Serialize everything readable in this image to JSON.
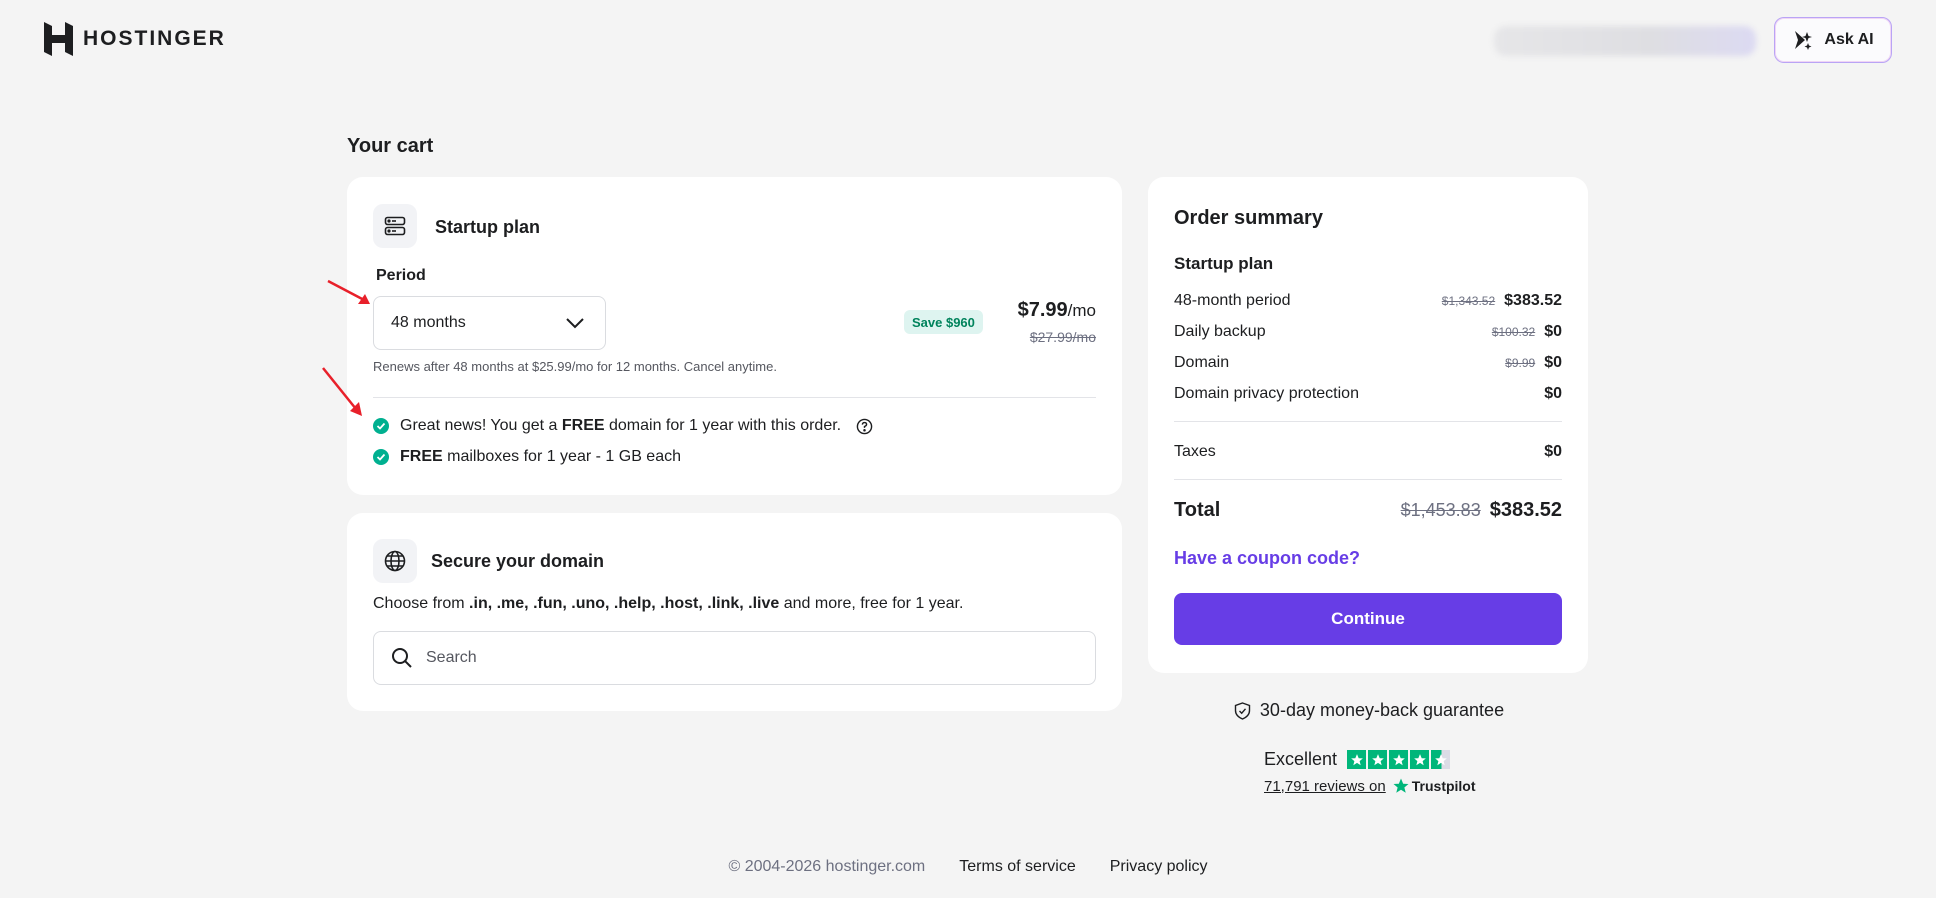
{
  "header": {
    "logo_text": "HOSTINGER",
    "ask_ai_label": "Ask AI"
  },
  "page_title": "Your cart",
  "plan_card": {
    "icon": "server-icon",
    "title": "Startup plan",
    "period_label": "Period",
    "period_value": "48 months",
    "save_badge": "Save $960",
    "price": "$7.99",
    "price_unit": "/mo",
    "old_price": "$27.99/mo",
    "renew_note": "Renews after 48 months at $25.99/mo for 12 months. Cancel anytime.",
    "perks": [
      {
        "pre": "Great news! You get a ",
        "bold": "FREE",
        "post": " domain for 1 year with this order."
      },
      {
        "pre": "",
        "bold": "FREE",
        "post": " mailboxes for 1 year - 1 GB each"
      }
    ]
  },
  "domain_card": {
    "icon": "globe-icon",
    "title": "Secure your domain",
    "desc_pre": "Choose from ",
    "desc_tlds": ".in, .me, .fun, .uno, .help, .host, .link, .live",
    "desc_post": " and more, free for 1 year.",
    "search_placeholder": "Search"
  },
  "summary": {
    "title": "Order summary",
    "plan_name": "Startup plan",
    "rows": [
      {
        "label": "48-month period",
        "old": "$1,343.52",
        "new": "$383.52"
      },
      {
        "label": "Daily backup",
        "old": "$100.32",
        "new": "$0"
      },
      {
        "label": "Domain",
        "old": "$9.99",
        "new": "$0"
      },
      {
        "label": "Domain privacy protection",
        "old": "",
        "new": "$0"
      }
    ],
    "taxes": {
      "label": "Taxes",
      "value": "$0"
    },
    "total": {
      "label": "Total",
      "old": "$1,453.83",
      "new": "$383.52"
    },
    "coupon_label": "Have a coupon code?",
    "continue_label": "Continue"
  },
  "guarantee": "30-day money-back guarantee",
  "trustpilot": {
    "rating_word": "Excellent",
    "stars": 4.5,
    "reviews_link": "71,791 reviews on",
    "brand": "Trustpilot"
  },
  "footer": {
    "copyright": "© 2004-2026 hostinger.com",
    "terms": "Terms of service",
    "privacy": "Privacy policy"
  },
  "colors": {
    "accent": "#673de6",
    "success": "#00b090",
    "trustpilot": "#00b67a"
  }
}
